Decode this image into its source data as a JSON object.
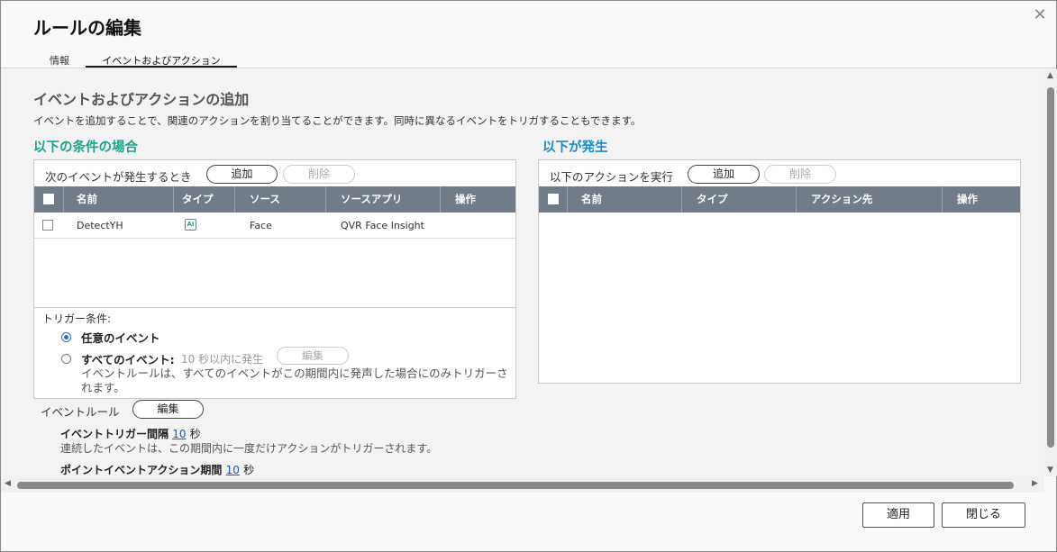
{
  "dialog": {
    "title": "ルールの編集",
    "close_icon": "close-icon"
  },
  "tabs": [
    {
      "label": "情報"
    },
    {
      "label": "イベントおよびアクション",
      "active": true
    }
  ],
  "section": {
    "heading": "イベントおよびアクションの追加",
    "description": "イベントを追加することで、関連のアクションを割り当てることができます。同時に異なるイベントをトリガすることもできます。"
  },
  "conditions": {
    "heading": "以下の条件の場合",
    "toolbar_label": "次のイベントが発生するとき",
    "add_label": "追加",
    "delete_label": "削除",
    "columns": [
      "名前",
      "タイプ",
      "ソース",
      "ソースアプリ",
      "操作"
    ],
    "rows": [
      {
        "name": "DetectYH",
        "type_icon": "AI",
        "source": "Face",
        "source_app": "QVR Face Insight"
      }
    ],
    "trigger": {
      "label": "トリガー条件:",
      "any_event": "任意のイベント",
      "all_events": "すべてのイベント:",
      "all_events_hint": "10 秒以内に発生",
      "edit_label": "編集",
      "note": "イベントルールは、すべてのイベントがこの期間内に発声した場合にのみトリガーされます。"
    }
  },
  "event_rule": {
    "label": "イベントルール",
    "edit_label": "編集",
    "interval_label": "イベントトリガー間隔",
    "interval_value": "10",
    "interval_unit": "秒",
    "interval_desc": "連続したイベントは、この期間内に一度だけアクションがトリガーされます。",
    "point_label": "ポイントイベントアクション期間",
    "point_value": "10",
    "point_unit": "秒"
  },
  "actions": {
    "heading": "以下が発生",
    "toolbar_label": "以下のアクションを実行",
    "add_label": "追加",
    "delete_label": "削除",
    "columns": [
      "名前",
      "タイプ",
      "アクション先",
      "操作"
    ]
  },
  "footer": {
    "apply_label": "適用",
    "close_label": "閉じる"
  },
  "colors": {
    "condition_heading": "#1aa58c",
    "action_heading": "#1a8ac9",
    "table_header": "#727b88",
    "link": "#1a55c9"
  }
}
